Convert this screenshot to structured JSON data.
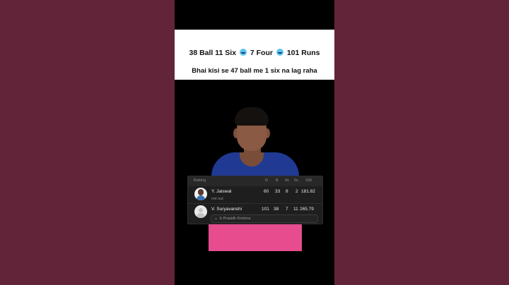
{
  "caption": {
    "line1_a": "38 Ball 11 Six",
    "line1_b": "7 Four",
    "line1_c": "101 Runs",
    "line2": "Bhai kisi se 47 ball me 1 six na lag raha",
    "emoji_icon": "cold-face-emoji",
    "emoji_color": "#5cc3ee"
  },
  "scorecard": {
    "header": {
      "label": "Batting",
      "r": "R",
      "b": "B",
      "fours": "4s",
      "sixes": "6s",
      "sr": "S/R"
    },
    "batters": [
      {
        "name": "Y. Jaiswal",
        "status": "not out",
        "r": "60",
        "b": "33",
        "fours": "8",
        "sixes": "2",
        "sr": "181.82"
      },
      {
        "name": "V. Suryavanshi",
        "status": "b Prasidh Krishna",
        "r": "101",
        "b": "38",
        "fours": "7",
        "sixes": "11",
        "sr": "265.79"
      }
    ]
  },
  "colors": {
    "background": "#612439",
    "jersey_pink": "#e64c8e",
    "jersey_blue": "#203a93"
  }
}
